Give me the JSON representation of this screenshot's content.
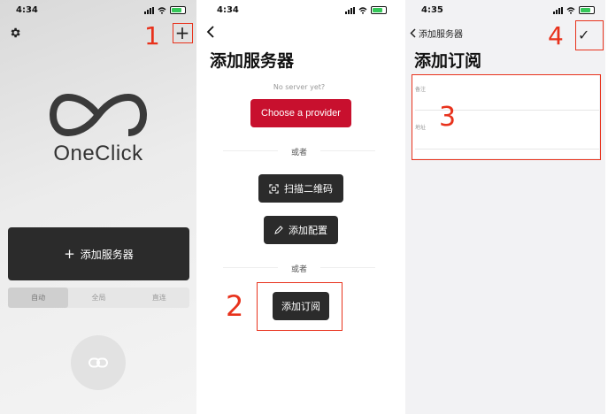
{
  "screens": [
    {
      "status_time": "4:34",
      "app_name": "OneClick",
      "add_server_label": "添加服务器",
      "segments": [
        "自动",
        "全局",
        "直连"
      ],
      "step_label": "1"
    },
    {
      "status_time": "4:34",
      "title": "添加服务器",
      "hint": "No server yet?",
      "provider_button": "Choose a provider",
      "or_label": "或者",
      "scan_qr_button": "扫描二维码",
      "add_config_button": "添加配置",
      "add_subscription_button": "添加订阅",
      "step_label": "2"
    },
    {
      "status_time": "4:35",
      "back_label": "添加服务器",
      "title": "添加订阅",
      "field_note_label": "备注",
      "field_address_label": "地址",
      "form_step_label": "3",
      "confirm_step_label": "4"
    }
  ],
  "colors": {
    "accent_red": "#c8102e",
    "annotation_red": "#e8321c",
    "dark_button": "#2b2b2b"
  },
  "icons": [
    "gear-icon",
    "plus-icon",
    "oneclick-logo",
    "link-icon",
    "back-chevron-icon",
    "qr-scan-icon",
    "pencil-icon",
    "checkmark-icon",
    "signal-icon",
    "wifi-icon",
    "battery-icon"
  ]
}
